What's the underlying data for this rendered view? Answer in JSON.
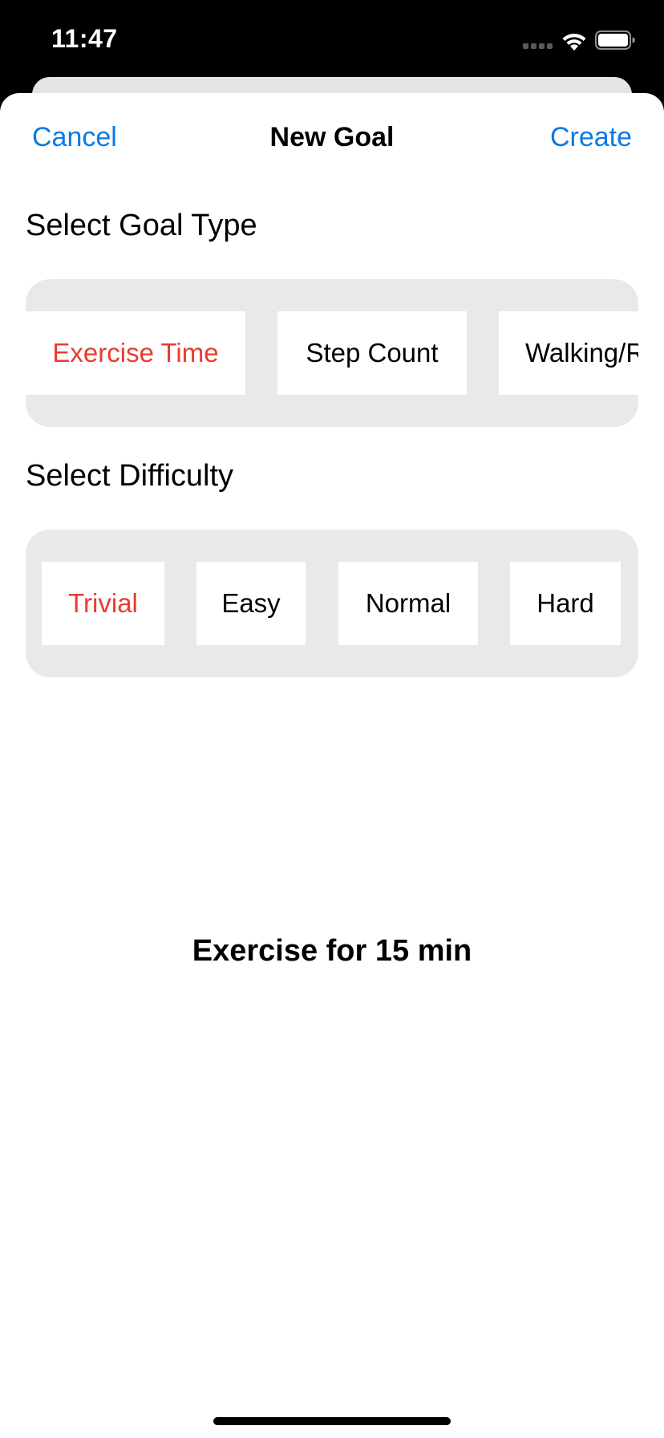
{
  "status_bar": {
    "time": "11:47",
    "icons": [
      "signal-icon",
      "wifi-icon",
      "battery-icon"
    ]
  },
  "nav": {
    "cancel_label": "Cancel",
    "title": "New Goal",
    "create_label": "Create"
  },
  "goal_type": {
    "heading": "Select Goal Type",
    "options": [
      "Exercise Time",
      "Step Count",
      "Walking/R"
    ],
    "selected_index": 0
  },
  "difficulty": {
    "heading": "Select Difficulty",
    "options": [
      "Trivial",
      "Easy",
      "Normal",
      "Hard"
    ],
    "selected_index": 0
  },
  "summary": "Exercise for 15 min",
  "colors": {
    "accent_blue": "#0a7ae4",
    "selected_red": "#ea3b2f",
    "selector_bg": "#e9e9eb"
  }
}
